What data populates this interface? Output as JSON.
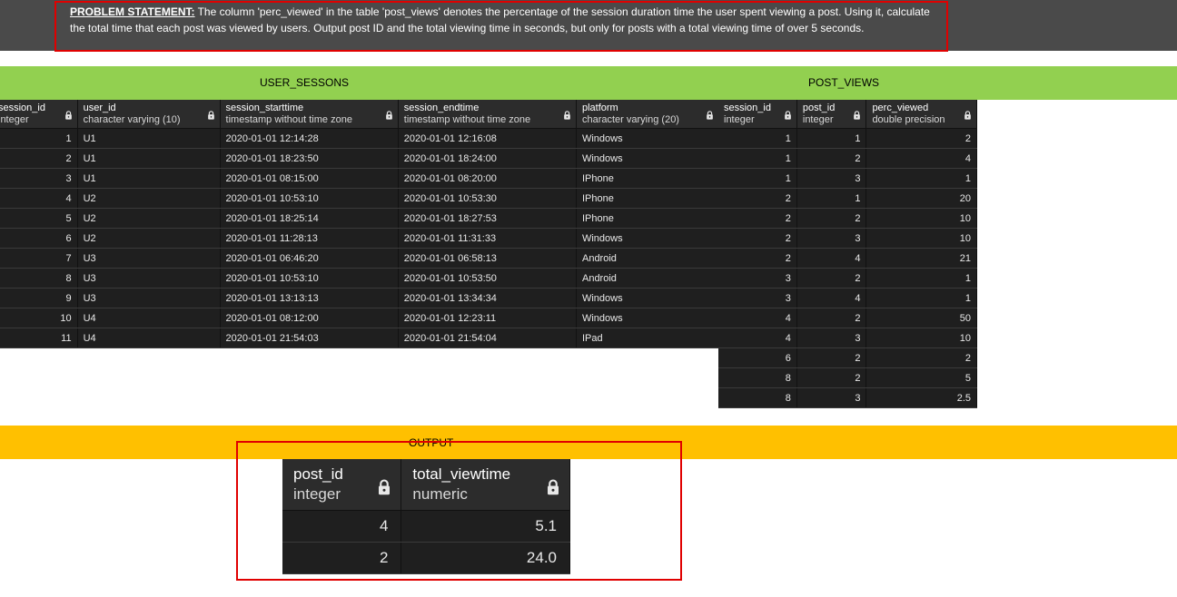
{
  "problem": {
    "label": "PROBLEM STATEMENT:",
    "text": "The column 'perc_viewed' in the table 'post_views' denotes the percentage of the session duration time the user spent viewing a post. Using it, calculate the total time that each post was viewed by users. Output post ID and the total viewing time in seconds, but only for posts with a total viewing time of over 5 seconds."
  },
  "titles": {
    "user_sessions": "USER_SESSONS",
    "post_views": "POST_VIEWS",
    "output": "OUTPUT"
  },
  "user_sessions": {
    "columns": [
      {
        "name": "session_id",
        "type": "integer"
      },
      {
        "name": "user_id",
        "type": "character varying (10)"
      },
      {
        "name": "session_starttime",
        "type": "timestamp without time zone"
      },
      {
        "name": "session_endtime",
        "type": "timestamp without time zone"
      },
      {
        "name": "platform",
        "type": "character varying (20)"
      }
    ],
    "rows": [
      [
        "1",
        "U1",
        "2020-01-01 12:14:28",
        "2020-01-01 12:16:08",
        "Windows"
      ],
      [
        "2",
        "U1",
        "2020-01-01 18:23:50",
        "2020-01-01 18:24:00",
        "Windows"
      ],
      [
        "3",
        "U1",
        "2020-01-01 08:15:00",
        "2020-01-01 08:20:00",
        "IPhone"
      ],
      [
        "4",
        "U2",
        "2020-01-01 10:53:10",
        "2020-01-01 10:53:30",
        "IPhone"
      ],
      [
        "5",
        "U2",
        "2020-01-01 18:25:14",
        "2020-01-01 18:27:53",
        "IPhone"
      ],
      [
        "6",
        "U2",
        "2020-01-01 11:28:13",
        "2020-01-01 11:31:33",
        "Windows"
      ],
      [
        "7",
        "U3",
        "2020-01-01 06:46:20",
        "2020-01-01 06:58:13",
        "Android"
      ],
      [
        "8",
        "U3",
        "2020-01-01 10:53:10",
        "2020-01-01 10:53:50",
        "Android"
      ],
      [
        "9",
        "U3",
        "2020-01-01 13:13:13",
        "2020-01-01 13:34:34",
        "Windows"
      ],
      [
        "10",
        "U4",
        "2020-01-01 08:12:00",
        "2020-01-01 12:23:11",
        "Windows"
      ],
      [
        "11",
        "U4",
        "2020-01-01 21:54:03",
        "2020-01-01 21:54:04",
        "IPad"
      ]
    ]
  },
  "post_views": {
    "columns": [
      {
        "name": "session_id",
        "type": "integer"
      },
      {
        "name": "post_id",
        "type": "integer"
      },
      {
        "name": "perc_viewed",
        "type": "double precision"
      }
    ],
    "rows": [
      [
        "1",
        "1",
        "2"
      ],
      [
        "1",
        "2",
        "4"
      ],
      [
        "1",
        "3",
        "1"
      ],
      [
        "2",
        "1",
        "20"
      ],
      [
        "2",
        "2",
        "10"
      ],
      [
        "2",
        "3",
        "10"
      ],
      [
        "2",
        "4",
        "21"
      ],
      [
        "3",
        "2",
        "1"
      ],
      [
        "3",
        "4",
        "1"
      ],
      [
        "4",
        "2",
        "50"
      ],
      [
        "4",
        "3",
        "10"
      ],
      [
        "6",
        "2",
        "2"
      ],
      [
        "8",
        "2",
        "5"
      ],
      [
        "8",
        "3",
        "2.5"
      ]
    ]
  },
  "output": {
    "columns": [
      {
        "name": "post_id",
        "type": "integer"
      },
      {
        "name": "total_viewtime",
        "type": "numeric"
      }
    ],
    "rows": [
      [
        "4",
        "5.1"
      ],
      [
        "2",
        "24.0"
      ]
    ]
  },
  "icons": {
    "column_lock": "lock-icon"
  }
}
